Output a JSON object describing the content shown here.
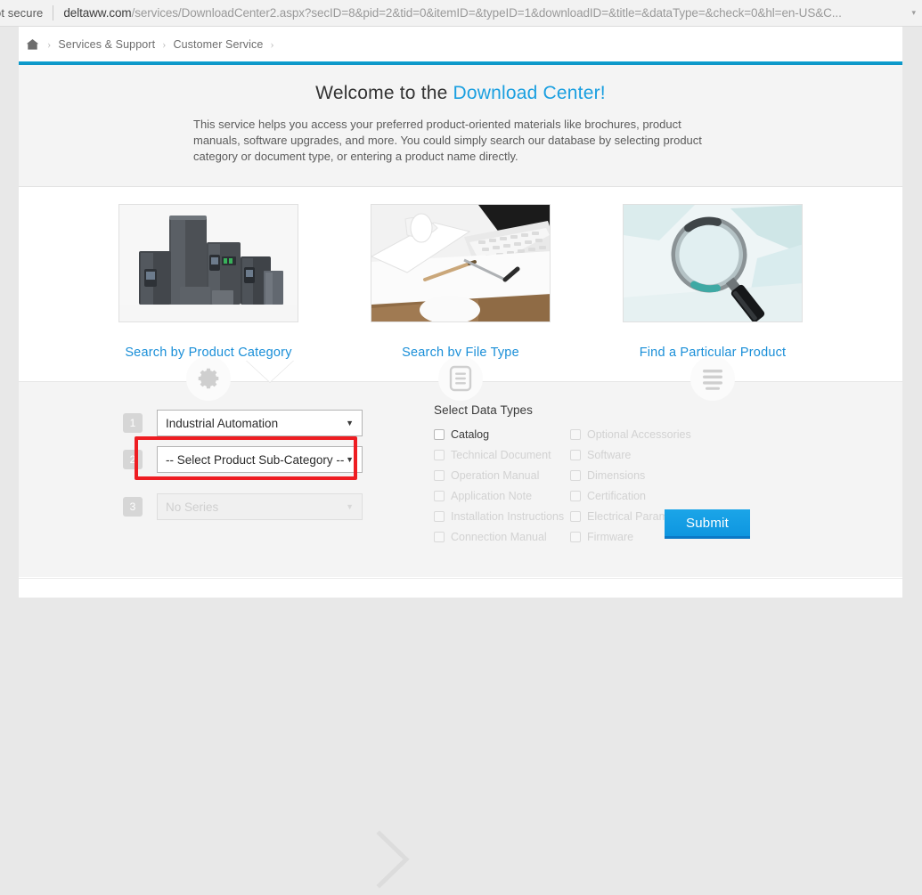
{
  "browser": {
    "security_label": "ot secure",
    "url_host": "deltaww.com",
    "url_path": "/services/DownloadCenter2.aspx?secID=8&pid=2&tid=0&itemID=&typeID=1&downloadID=&title=&dataType=&check=0&hl=en-US&C...",
    "menu_caret": "▾"
  },
  "breadcrumb": {
    "home_icon": "home-icon",
    "separator": "›",
    "items": [
      {
        "label": "Services & Support"
      },
      {
        "label": "Customer Service"
      }
    ]
  },
  "welcome": {
    "title_plain": "Welcome to the ",
    "title_accent": "Download Center!",
    "description": "This service helps you access your preferred product-oriented materials like brochures, product manuals, software upgrades, and more. You could simply search our database by selecting product category or document type, or entering a product name directly."
  },
  "cards": [
    {
      "label": "Search by Product Category",
      "icon": "gear-icon",
      "art": "product-drives-photo"
    },
    {
      "label": "Search by File Type",
      "icon": "document-lines-icon",
      "art": "desk-blueprint-photo"
    },
    {
      "label": "Find a Particular Product",
      "icon": "list-lines-icon",
      "art": "magnifier-photo"
    }
  ],
  "selector": {
    "steps": [
      {
        "number": "1",
        "value": "Industrial Automation",
        "caret": "▼",
        "disabled": false,
        "highlighted": false
      },
      {
        "number": "2",
        "value": "-- Select Product Sub-Category --",
        "caret": "▼",
        "disabled": false,
        "highlighted": true
      },
      {
        "number": "3",
        "value": "No Series",
        "caret": "▼",
        "disabled": true,
        "highlighted": false
      }
    ],
    "highlight_color": "#ee1d22",
    "chevron_icon": "chevron-right-icon"
  },
  "data_types": {
    "title": "Select Data Types",
    "items": [
      {
        "label": "Catalog",
        "enabled": true
      },
      {
        "label": "Optional Accessories",
        "enabled": false
      },
      {
        "label": "Technical Document",
        "enabled": false
      },
      {
        "label": "Software",
        "enabled": false
      },
      {
        "label": "Operation Manual",
        "enabled": false
      },
      {
        "label": "Dimensions",
        "enabled": false
      },
      {
        "label": "Application Note",
        "enabled": false
      },
      {
        "label": "Certification",
        "enabled": false
      },
      {
        "label": "Installation Instructions",
        "enabled": false
      },
      {
        "label": "Electrical Parameter",
        "enabled": false
      },
      {
        "label": "Connection Manual",
        "enabled": false
      },
      {
        "label": "Firmware",
        "enabled": false
      }
    ]
  },
  "submit": {
    "label": "Submit",
    "color": "#11a0e6"
  }
}
